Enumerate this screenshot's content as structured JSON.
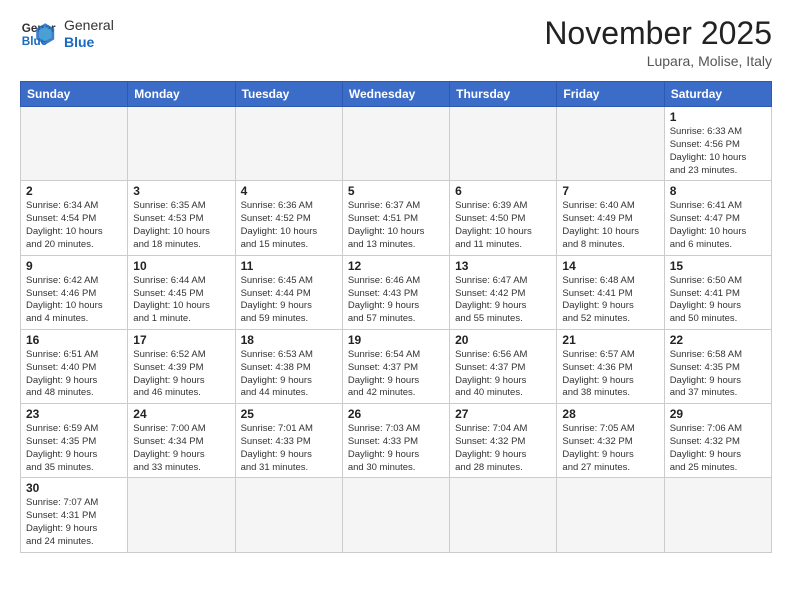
{
  "logo": {
    "text_general": "General",
    "text_blue": "Blue"
  },
  "header": {
    "title": "November 2025",
    "subtitle": "Lupara, Molise, Italy"
  },
  "weekdays": [
    "Sunday",
    "Monday",
    "Tuesday",
    "Wednesday",
    "Thursday",
    "Friday",
    "Saturday"
  ],
  "weeks": [
    [
      {
        "day": "",
        "info": ""
      },
      {
        "day": "",
        "info": ""
      },
      {
        "day": "",
        "info": ""
      },
      {
        "day": "",
        "info": ""
      },
      {
        "day": "",
        "info": ""
      },
      {
        "day": "",
        "info": ""
      },
      {
        "day": "1",
        "info": "Sunrise: 6:33 AM\nSunset: 4:56 PM\nDaylight: 10 hours\nand 23 minutes."
      }
    ],
    [
      {
        "day": "2",
        "info": "Sunrise: 6:34 AM\nSunset: 4:54 PM\nDaylight: 10 hours\nand 20 minutes."
      },
      {
        "day": "3",
        "info": "Sunrise: 6:35 AM\nSunset: 4:53 PM\nDaylight: 10 hours\nand 18 minutes."
      },
      {
        "day": "4",
        "info": "Sunrise: 6:36 AM\nSunset: 4:52 PM\nDaylight: 10 hours\nand 15 minutes."
      },
      {
        "day": "5",
        "info": "Sunrise: 6:37 AM\nSunset: 4:51 PM\nDaylight: 10 hours\nand 13 minutes."
      },
      {
        "day": "6",
        "info": "Sunrise: 6:39 AM\nSunset: 4:50 PM\nDaylight: 10 hours\nand 11 minutes."
      },
      {
        "day": "7",
        "info": "Sunrise: 6:40 AM\nSunset: 4:49 PM\nDaylight: 10 hours\nand 8 minutes."
      },
      {
        "day": "8",
        "info": "Sunrise: 6:41 AM\nSunset: 4:47 PM\nDaylight: 10 hours\nand 6 minutes."
      }
    ],
    [
      {
        "day": "9",
        "info": "Sunrise: 6:42 AM\nSunset: 4:46 PM\nDaylight: 10 hours\nand 4 minutes."
      },
      {
        "day": "10",
        "info": "Sunrise: 6:44 AM\nSunset: 4:45 PM\nDaylight: 10 hours\nand 1 minute."
      },
      {
        "day": "11",
        "info": "Sunrise: 6:45 AM\nSunset: 4:44 PM\nDaylight: 9 hours\nand 59 minutes."
      },
      {
        "day": "12",
        "info": "Sunrise: 6:46 AM\nSunset: 4:43 PM\nDaylight: 9 hours\nand 57 minutes."
      },
      {
        "day": "13",
        "info": "Sunrise: 6:47 AM\nSunset: 4:42 PM\nDaylight: 9 hours\nand 55 minutes."
      },
      {
        "day": "14",
        "info": "Sunrise: 6:48 AM\nSunset: 4:41 PM\nDaylight: 9 hours\nand 52 minutes."
      },
      {
        "day": "15",
        "info": "Sunrise: 6:50 AM\nSunset: 4:41 PM\nDaylight: 9 hours\nand 50 minutes."
      }
    ],
    [
      {
        "day": "16",
        "info": "Sunrise: 6:51 AM\nSunset: 4:40 PM\nDaylight: 9 hours\nand 48 minutes."
      },
      {
        "day": "17",
        "info": "Sunrise: 6:52 AM\nSunset: 4:39 PM\nDaylight: 9 hours\nand 46 minutes."
      },
      {
        "day": "18",
        "info": "Sunrise: 6:53 AM\nSunset: 4:38 PM\nDaylight: 9 hours\nand 44 minutes."
      },
      {
        "day": "19",
        "info": "Sunrise: 6:54 AM\nSunset: 4:37 PM\nDaylight: 9 hours\nand 42 minutes."
      },
      {
        "day": "20",
        "info": "Sunrise: 6:56 AM\nSunset: 4:37 PM\nDaylight: 9 hours\nand 40 minutes."
      },
      {
        "day": "21",
        "info": "Sunrise: 6:57 AM\nSunset: 4:36 PM\nDaylight: 9 hours\nand 38 minutes."
      },
      {
        "day": "22",
        "info": "Sunrise: 6:58 AM\nSunset: 4:35 PM\nDaylight: 9 hours\nand 37 minutes."
      }
    ],
    [
      {
        "day": "23",
        "info": "Sunrise: 6:59 AM\nSunset: 4:35 PM\nDaylight: 9 hours\nand 35 minutes."
      },
      {
        "day": "24",
        "info": "Sunrise: 7:00 AM\nSunset: 4:34 PM\nDaylight: 9 hours\nand 33 minutes."
      },
      {
        "day": "25",
        "info": "Sunrise: 7:01 AM\nSunset: 4:33 PM\nDaylight: 9 hours\nand 31 minutes."
      },
      {
        "day": "26",
        "info": "Sunrise: 7:03 AM\nSunset: 4:33 PM\nDaylight: 9 hours\nand 30 minutes."
      },
      {
        "day": "27",
        "info": "Sunrise: 7:04 AM\nSunset: 4:32 PM\nDaylight: 9 hours\nand 28 minutes."
      },
      {
        "day": "28",
        "info": "Sunrise: 7:05 AM\nSunset: 4:32 PM\nDaylight: 9 hours\nand 27 minutes."
      },
      {
        "day": "29",
        "info": "Sunrise: 7:06 AM\nSunset: 4:32 PM\nDaylight: 9 hours\nand 25 minutes."
      }
    ],
    [
      {
        "day": "30",
        "info": "Sunrise: 7:07 AM\nSunset: 4:31 PM\nDaylight: 9 hours\nand 24 minutes."
      },
      {
        "day": "",
        "info": ""
      },
      {
        "day": "",
        "info": ""
      },
      {
        "day": "",
        "info": ""
      },
      {
        "day": "",
        "info": ""
      },
      {
        "day": "",
        "info": ""
      },
      {
        "day": "",
        "info": ""
      }
    ]
  ]
}
